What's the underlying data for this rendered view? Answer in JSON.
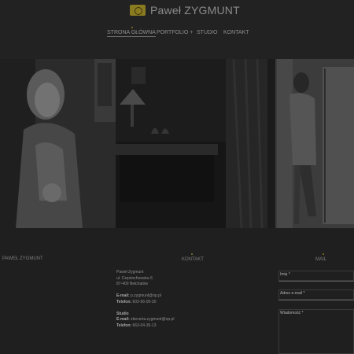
{
  "header": {
    "logo_text": "Paweł ZYGMUNT",
    "nav": [
      {
        "label": "STRONA GŁÓWNA",
        "active": true
      },
      {
        "label": "PORTFOLIO +"
      },
      {
        "label": "STUDIO"
      },
      {
        "label": "KONTAKT"
      }
    ]
  },
  "footer": {
    "left_title": "PAWEŁ ZYGMUNT",
    "contact_title": "KONTAKT",
    "mail_title": "MAIL",
    "contact": {
      "name": "Paweł Zygmunt",
      "street": "ul. Częstochowska 6",
      "city": "87-400 Bełchatów",
      "email_label": "E-mail:",
      "email": "p.zygmunt@op.pl",
      "phone_label": "Telefon:",
      "phone": "603-56-00-30",
      "studio_label": "Studio",
      "studio_email_label": "E-mail:",
      "studio_email": "zbecerta.zygmunt@op.pl",
      "studio_phone_label": "Telefon:",
      "studio_phone": "663-04-35-13"
    },
    "mail_form": {
      "name_label": "Imię *",
      "email_label": "Adres e-mail *",
      "message_label": "Wiadomość *"
    }
  },
  "colors": {
    "accent": "#8a7a20",
    "background": "#1f1f1f"
  }
}
